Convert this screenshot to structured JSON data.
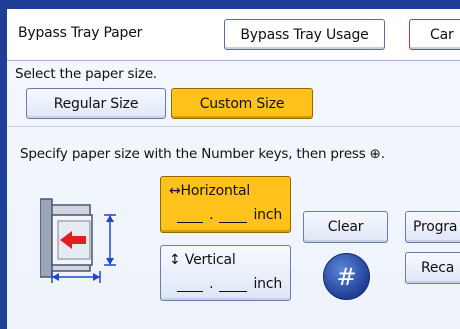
{
  "header": {
    "title": "Bypass Tray Paper",
    "usage_button": "Bypass Tray Usage",
    "cancel_button": "Car"
  },
  "paper_size": {
    "prompt": "Select the paper size.",
    "regular_label": "Regular Size",
    "custom_label": "Custom Size",
    "selected": "Custom Size"
  },
  "instructions": {
    "text": "Specify paper size with the Number keys, then press ⊕."
  },
  "dimensions": {
    "horizontal": {
      "label": "↔Horizontal",
      "sep": ".",
      "unit": "inch"
    },
    "vertical": {
      "label": "↕ Vertical",
      "sep": ".",
      "unit": "inch"
    }
  },
  "keys": {
    "clear": "Clear",
    "program": "Progra",
    "recall": "Reca",
    "hash": "#"
  },
  "icons": {
    "tray": "bypass-tray-icon",
    "hash": "hash-key-icon"
  },
  "colors": {
    "selected": "#ffc21a",
    "frame": "#1f3f97"
  }
}
